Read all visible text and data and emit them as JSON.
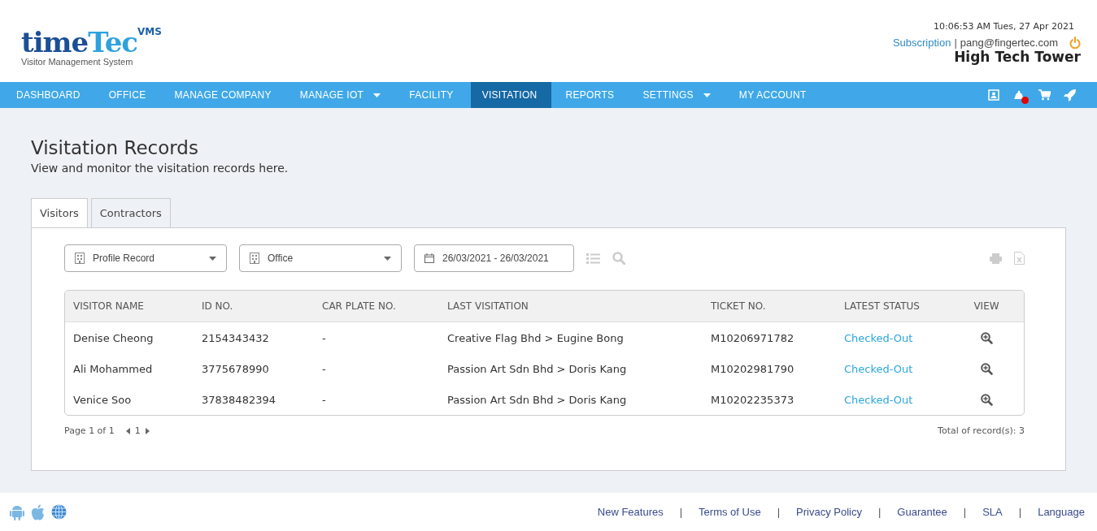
{
  "logo": {
    "word_dark": "time",
    "word_light": "Tec",
    "badge": "VMS",
    "tagline": "Visitor Management System"
  },
  "header": {
    "datetime": "10:06:53 AM  Tues, 27 Apr 2021",
    "subscription_link": "Subscription",
    "separator": "|",
    "email": "pang@fingertec.com",
    "site_name": "High Tech Tower"
  },
  "nav": {
    "items": [
      {
        "label": "DASHBOARD",
        "selected": false,
        "dropdown": false
      },
      {
        "label": "OFFICE",
        "selected": false,
        "dropdown": false
      },
      {
        "label": "MANAGE COMPANY",
        "selected": false,
        "dropdown": false
      },
      {
        "label": "MANAGE IOT",
        "selected": false,
        "dropdown": true
      },
      {
        "label": "FACILITY",
        "selected": false,
        "dropdown": false
      },
      {
        "label": "VISITATION",
        "selected": true,
        "dropdown": false
      },
      {
        "label": "REPORTS",
        "selected": false,
        "dropdown": false
      },
      {
        "label": "SETTINGS",
        "selected": false,
        "dropdown": true
      },
      {
        "label": "MY ACCOUNT",
        "selected": false,
        "dropdown": false
      }
    ],
    "notification_unread": true
  },
  "page": {
    "title": "Visitation Records",
    "subtitle": "View and monitor the visitation records here."
  },
  "tabs": [
    {
      "label": "Visitors",
      "selected": true
    },
    {
      "label": "Contractors",
      "selected": false
    }
  ],
  "filters": {
    "record_type": "Profile Record",
    "location": "Office",
    "date_range": "26/03/2021 - 26/03/2021"
  },
  "table": {
    "columns": [
      "VISITOR NAME",
      "ID NO.",
      "CAR PLATE NO.",
      "LAST VISITATION",
      "TICKET NO.",
      "LATEST STATUS",
      "VIEW"
    ],
    "rows": [
      {
        "name": "Denise Cheong",
        "id": "2154343432",
        "car_plate": "-",
        "last_visitation": "Creative Flag Bhd > Eugine Bong",
        "ticket": "M10206971782",
        "status": "Checked-Out"
      },
      {
        "name": "Ali Mohammed",
        "id": "3775678990",
        "car_plate": "-",
        "last_visitation": "Passion Art Sdn Bhd > Doris Kang",
        "ticket": "M10202981790",
        "status": "Checked-Out"
      },
      {
        "name": "Venice Soo",
        "id": "37838482394",
        "car_plate": "-",
        "last_visitation": "Passion Art Sdn Bhd > Doris Kang",
        "ticket": "M10202235373",
        "status": "Checked-Out"
      }
    ]
  },
  "pagination": {
    "page_info": "Page 1 of 1",
    "current_page": "1",
    "total": "Total of record(s): 3"
  },
  "footer": {
    "links": [
      "New Features",
      "Terms of Use",
      "Privacy Policy",
      "Guarantee",
      "SLA",
      "Language"
    ],
    "separator": "|"
  }
}
